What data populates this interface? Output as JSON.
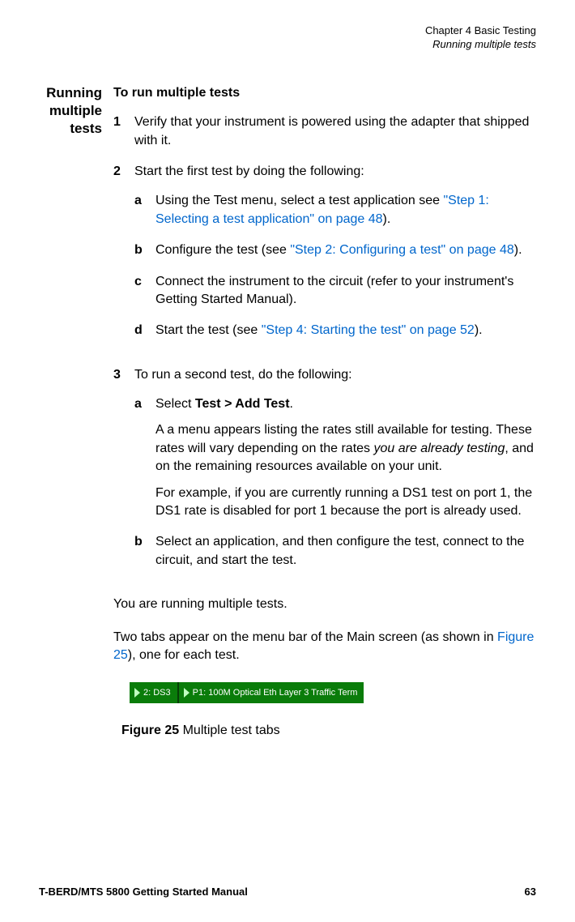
{
  "header": {
    "chapter": "Chapter 4  Basic Testing",
    "section": "Running multiple tests"
  },
  "sectionTitle": "Running multiple tests",
  "subtitle": "To run multiple tests",
  "steps": {
    "s1": {
      "num": "1",
      "text": "Verify that your instrument is powered using the adapter that shipped with it."
    },
    "s2": {
      "num": "2",
      "text": "Start the first test by doing the following:",
      "a": {
        "label": "a",
        "pre": "Using the Test menu, select a test application see ",
        "link": "\"Step 1: Selecting a test application\" on page 48",
        "post": ")."
      },
      "b": {
        "label": "b",
        "pre": "Configure the test (see ",
        "link": "\"Step 2: Configuring a test\" on page 48",
        "post": ")."
      },
      "c": {
        "label": "c",
        "text": "Connect the instrument to the circuit (refer to your instrument's Getting Started Manual)."
      },
      "d": {
        "label": "d",
        "pre": "Start the test (see ",
        "link": "\"Step 4: Starting the test\" on page 52",
        "post": ")."
      }
    },
    "s3": {
      "num": "3",
      "text": "To run a second test, do the following:",
      "a": {
        "label": "a",
        "pre": "Select ",
        "bold": "Test > Add Test",
        "post": ".",
        "p1a": "A a menu appears listing the rates still available for testing. These rates will vary depending on the rates ",
        "p1i": "you are already testing",
        "p1b": ", and on the remaining resources available on your unit.",
        "p2": "For example, if you are currently running a DS1 test on port 1, the DS1 rate is disabled for port 1 because the port is already used."
      },
      "b": {
        "label": "b",
        "text": "Select an application, and then configure the test, connect to the circuit, and start the test."
      }
    }
  },
  "closing1": "You are running multiple tests.",
  "closing2a": "Two tabs appear on the menu bar of the Main screen (as shown in ",
  "closing2link": "Figure 25",
  "closing2b": "), one for each test.",
  "tabs": {
    "t1": "2: DS3",
    "t2": "P1: 100M Optical Eth Layer 3 Traffic Term"
  },
  "figcap": {
    "label": "Figure 25",
    "text": "  Multiple test tabs"
  },
  "footer": {
    "manual": "T-BERD/MTS 5800 Getting Started Manual",
    "page": "63"
  }
}
